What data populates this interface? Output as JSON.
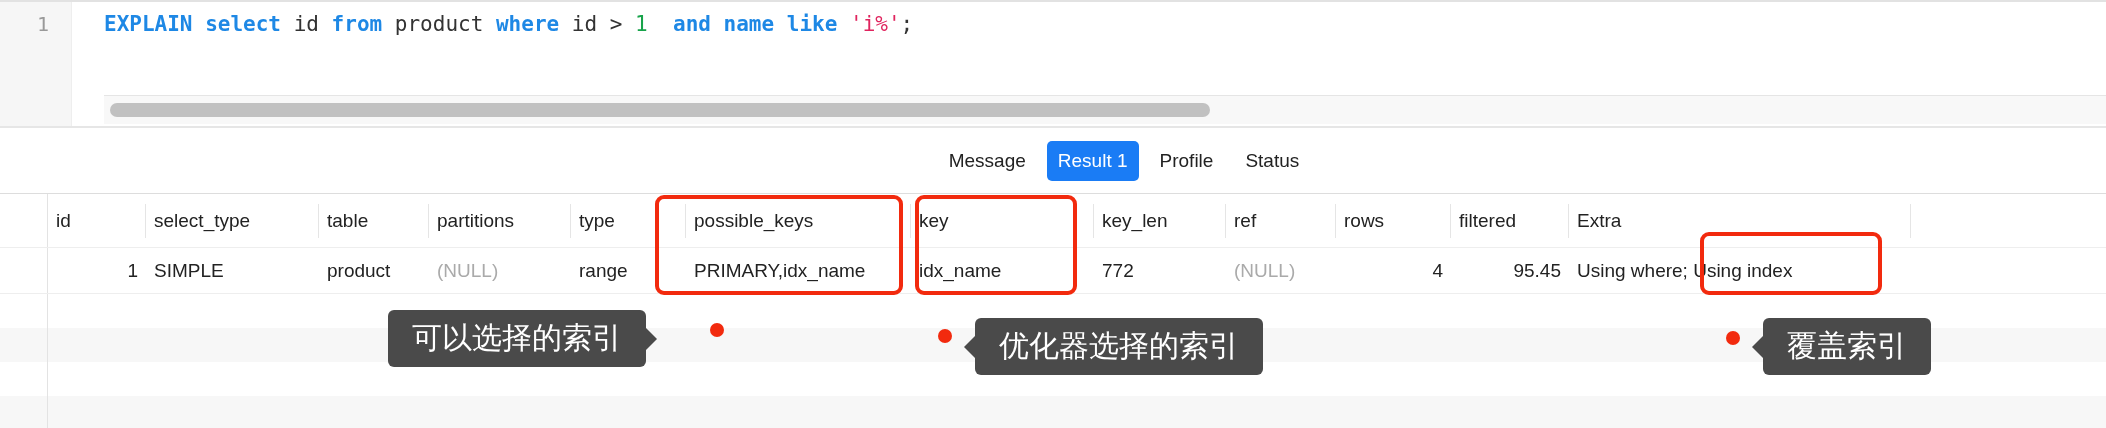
{
  "editor": {
    "line_numbers": [
      "1"
    ],
    "code_tokens": [
      {
        "text": "EXPLAIN ",
        "kind": "keyword"
      },
      {
        "text": "select",
        "kind": "keyword"
      },
      {
        "text": " id ",
        "kind": "plain"
      },
      {
        "text": "from",
        "kind": "keyword"
      },
      {
        "text": " product ",
        "kind": "plain"
      },
      {
        "text": "where",
        "kind": "keyword"
      },
      {
        "text": " id > ",
        "kind": "plain"
      },
      {
        "text": "1  ",
        "kind": "number"
      },
      {
        "text": "and ",
        "kind": "keyword"
      },
      {
        "text": "name ",
        "kind": "keyword"
      },
      {
        "text": "like ",
        "kind": "keyword"
      },
      {
        "text": "'i%'",
        "kind": "string"
      },
      {
        "text": ";",
        "kind": "plain"
      }
    ]
  },
  "tabs": [
    {
      "label": "Message",
      "selected": false
    },
    {
      "label": "Result 1",
      "selected": true
    },
    {
      "label": "Profile",
      "selected": false
    },
    {
      "label": "Status",
      "selected": false
    }
  ],
  "table": {
    "columns": [
      "id",
      "select_type",
      "table",
      "partitions",
      "type",
      "possible_keys",
      "key",
      "key_len",
      "ref",
      "rows",
      "filtered",
      "Extra"
    ],
    "rows": [
      [
        {
          "text": "1",
          "kind": "number"
        },
        {
          "text": "SIMPLE",
          "kind": "text"
        },
        {
          "text": "product",
          "kind": "text"
        },
        {
          "text": "(NULL)",
          "kind": "null"
        },
        {
          "text": "range",
          "kind": "text"
        },
        {
          "text": "PRIMARY,idx_name",
          "kind": "text"
        },
        {
          "text": "idx_name",
          "kind": "text"
        },
        {
          "text": "772",
          "kind": "text"
        },
        {
          "text": "(NULL)",
          "kind": "null"
        },
        {
          "text": "4",
          "kind": "number"
        },
        {
          "text": "95.45",
          "kind": "number"
        },
        {
          "text": "Using where; Using index",
          "kind": "text"
        }
      ]
    ]
  },
  "callouts": [
    {
      "text": "可以选择的索引"
    },
    {
      "text": "优化器选择的索引"
    },
    {
      "text": "覆盖索引"
    }
  ]
}
